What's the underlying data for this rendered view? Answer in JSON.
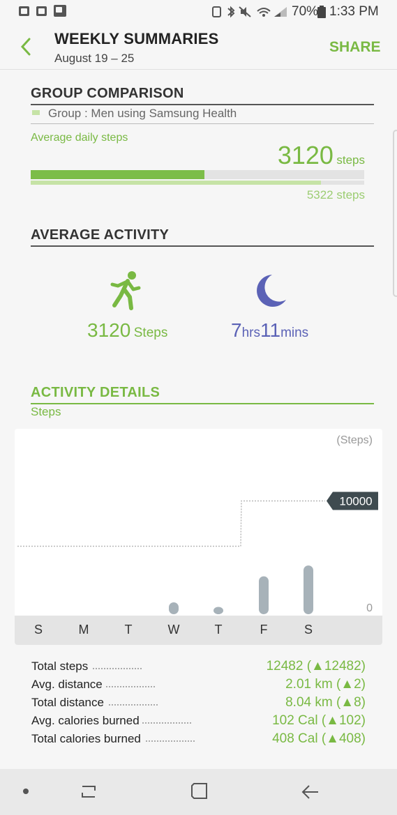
{
  "status_bar": {
    "battery": "70%",
    "time": "1:33 PM"
  },
  "header": {
    "title": "WEEKLY SUMMARIES",
    "date_range": "August 19 – 25",
    "share_label": "SHARE"
  },
  "group_comparison": {
    "section_title": "GROUP COMPARISON",
    "group_legend": "Group : Men using Samsung Health",
    "metric_label": "Average daily steps",
    "user_steps": "3120",
    "user_steps_unit": "steps",
    "group_steps_label": "5322 steps",
    "user_fraction": 0.52,
    "group_fraction": 0.87,
    "colors": {
      "user": "#7cbd48",
      "group": "#c6e3a6"
    }
  },
  "average_activity": {
    "section_title": "AVERAGE ACTIVITY",
    "steps_value": "3120",
    "steps_unit": "Steps",
    "sleep_hours": "7",
    "sleep_hours_unit": "hrs",
    "sleep_mins": "11",
    "sleep_mins_unit": "mins",
    "icons": {
      "activity": "running-person-icon",
      "sleep": "crescent-moon-icon"
    },
    "colors": {
      "steps": "#79b943",
      "sleep": "#5b62b6"
    }
  },
  "activity_details": {
    "section_title": "ACTIVITY DETAILS",
    "metric_tab": "Steps",
    "chart_unit": "(Steps)",
    "goal_label": "10000",
    "zero_label": "0"
  },
  "chart_data": {
    "type": "bar",
    "ylabel": "(Steps)",
    "categories": [
      "S",
      "M",
      "T",
      "W",
      "T",
      "F",
      "S"
    ],
    "values": [
      0,
      0,
      0,
      1050,
      650,
      3350,
      4300
    ],
    "goal": [
      6000,
      6000,
      6000,
      6000,
      6000,
      10000,
      10000
    ],
    "goal_label": "10000",
    "ylim": [
      0,
      16000
    ],
    "colors": {
      "bar": "#a7b2b9"
    }
  },
  "stats": [
    {
      "label": "Total steps",
      "value": "12482 (▲12482)"
    },
    {
      "label": "Avg. distance",
      "value": "2.01 km (▲2)"
    },
    {
      "label": "Total distance",
      "value": "8.04 km (▲8)"
    },
    {
      "label": "Avg. calories burned",
      "value": "102 Cal (▲102)"
    },
    {
      "label": "Total calories burned",
      "value": "408 Cal (▲408)"
    }
  ],
  "nav_bar": {
    "icons": [
      "dot-icon",
      "recent-apps-icon",
      "home-icon",
      "back-arrow-icon"
    ]
  }
}
